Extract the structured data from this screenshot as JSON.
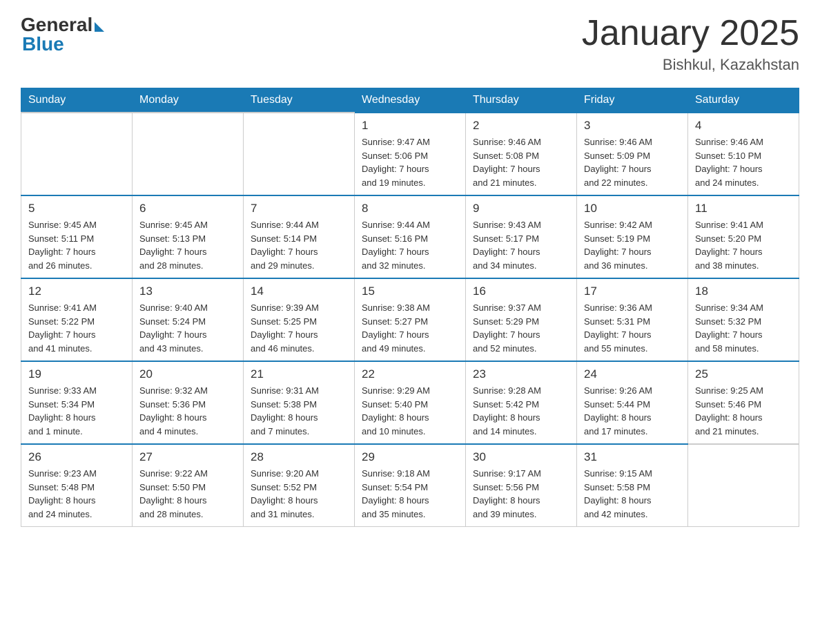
{
  "header": {
    "logo": {
      "general": "General",
      "blue": "Blue"
    },
    "title": "January 2025",
    "location": "Bishkul, Kazakhstan"
  },
  "days_of_week": [
    "Sunday",
    "Monday",
    "Tuesday",
    "Wednesday",
    "Thursday",
    "Friday",
    "Saturday"
  ],
  "weeks": [
    [
      {
        "day": "",
        "info": ""
      },
      {
        "day": "",
        "info": ""
      },
      {
        "day": "",
        "info": ""
      },
      {
        "day": "1",
        "info": "Sunrise: 9:47 AM\nSunset: 5:06 PM\nDaylight: 7 hours\nand 19 minutes."
      },
      {
        "day": "2",
        "info": "Sunrise: 9:46 AM\nSunset: 5:08 PM\nDaylight: 7 hours\nand 21 minutes."
      },
      {
        "day": "3",
        "info": "Sunrise: 9:46 AM\nSunset: 5:09 PM\nDaylight: 7 hours\nand 22 minutes."
      },
      {
        "day": "4",
        "info": "Sunrise: 9:46 AM\nSunset: 5:10 PM\nDaylight: 7 hours\nand 24 minutes."
      }
    ],
    [
      {
        "day": "5",
        "info": "Sunrise: 9:45 AM\nSunset: 5:11 PM\nDaylight: 7 hours\nand 26 minutes."
      },
      {
        "day": "6",
        "info": "Sunrise: 9:45 AM\nSunset: 5:13 PM\nDaylight: 7 hours\nand 28 minutes."
      },
      {
        "day": "7",
        "info": "Sunrise: 9:44 AM\nSunset: 5:14 PM\nDaylight: 7 hours\nand 29 minutes."
      },
      {
        "day": "8",
        "info": "Sunrise: 9:44 AM\nSunset: 5:16 PM\nDaylight: 7 hours\nand 32 minutes."
      },
      {
        "day": "9",
        "info": "Sunrise: 9:43 AM\nSunset: 5:17 PM\nDaylight: 7 hours\nand 34 minutes."
      },
      {
        "day": "10",
        "info": "Sunrise: 9:42 AM\nSunset: 5:19 PM\nDaylight: 7 hours\nand 36 minutes."
      },
      {
        "day": "11",
        "info": "Sunrise: 9:41 AM\nSunset: 5:20 PM\nDaylight: 7 hours\nand 38 minutes."
      }
    ],
    [
      {
        "day": "12",
        "info": "Sunrise: 9:41 AM\nSunset: 5:22 PM\nDaylight: 7 hours\nand 41 minutes."
      },
      {
        "day": "13",
        "info": "Sunrise: 9:40 AM\nSunset: 5:24 PM\nDaylight: 7 hours\nand 43 minutes."
      },
      {
        "day": "14",
        "info": "Sunrise: 9:39 AM\nSunset: 5:25 PM\nDaylight: 7 hours\nand 46 minutes."
      },
      {
        "day": "15",
        "info": "Sunrise: 9:38 AM\nSunset: 5:27 PM\nDaylight: 7 hours\nand 49 minutes."
      },
      {
        "day": "16",
        "info": "Sunrise: 9:37 AM\nSunset: 5:29 PM\nDaylight: 7 hours\nand 52 minutes."
      },
      {
        "day": "17",
        "info": "Sunrise: 9:36 AM\nSunset: 5:31 PM\nDaylight: 7 hours\nand 55 minutes."
      },
      {
        "day": "18",
        "info": "Sunrise: 9:34 AM\nSunset: 5:32 PM\nDaylight: 7 hours\nand 58 minutes."
      }
    ],
    [
      {
        "day": "19",
        "info": "Sunrise: 9:33 AM\nSunset: 5:34 PM\nDaylight: 8 hours\nand 1 minute."
      },
      {
        "day": "20",
        "info": "Sunrise: 9:32 AM\nSunset: 5:36 PM\nDaylight: 8 hours\nand 4 minutes."
      },
      {
        "day": "21",
        "info": "Sunrise: 9:31 AM\nSunset: 5:38 PM\nDaylight: 8 hours\nand 7 minutes."
      },
      {
        "day": "22",
        "info": "Sunrise: 9:29 AM\nSunset: 5:40 PM\nDaylight: 8 hours\nand 10 minutes."
      },
      {
        "day": "23",
        "info": "Sunrise: 9:28 AM\nSunset: 5:42 PM\nDaylight: 8 hours\nand 14 minutes."
      },
      {
        "day": "24",
        "info": "Sunrise: 9:26 AM\nSunset: 5:44 PM\nDaylight: 8 hours\nand 17 minutes."
      },
      {
        "day": "25",
        "info": "Sunrise: 9:25 AM\nSunset: 5:46 PM\nDaylight: 8 hours\nand 21 minutes."
      }
    ],
    [
      {
        "day": "26",
        "info": "Sunrise: 9:23 AM\nSunset: 5:48 PM\nDaylight: 8 hours\nand 24 minutes."
      },
      {
        "day": "27",
        "info": "Sunrise: 9:22 AM\nSunset: 5:50 PM\nDaylight: 8 hours\nand 28 minutes."
      },
      {
        "day": "28",
        "info": "Sunrise: 9:20 AM\nSunset: 5:52 PM\nDaylight: 8 hours\nand 31 minutes."
      },
      {
        "day": "29",
        "info": "Sunrise: 9:18 AM\nSunset: 5:54 PM\nDaylight: 8 hours\nand 35 minutes."
      },
      {
        "day": "30",
        "info": "Sunrise: 9:17 AM\nSunset: 5:56 PM\nDaylight: 8 hours\nand 39 minutes."
      },
      {
        "day": "31",
        "info": "Sunrise: 9:15 AM\nSunset: 5:58 PM\nDaylight: 8 hours\nand 42 minutes."
      },
      {
        "day": "",
        "info": ""
      }
    ]
  ]
}
